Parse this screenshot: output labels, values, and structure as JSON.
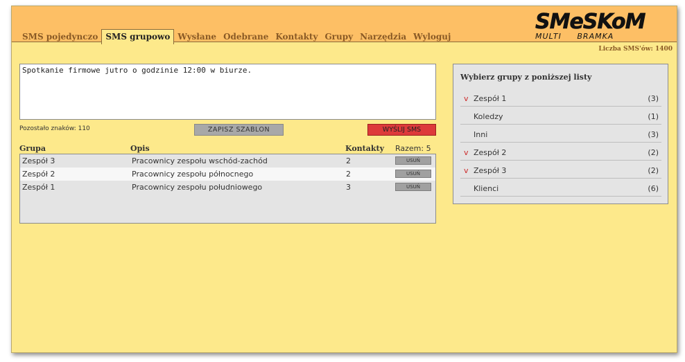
{
  "app": {
    "logo_text": "SMeSKoM",
    "logo_sub": "MULTI BRAMKA"
  },
  "nav": {
    "tabs": [
      {
        "label": "SMS pojedynczo"
      },
      {
        "label": "SMS grupowo"
      },
      {
        "label": "Wysłane"
      },
      {
        "label": "Odebrane"
      },
      {
        "label": "Kontakty"
      },
      {
        "label": "Grupy"
      },
      {
        "label": "Narzędzia"
      },
      {
        "label": "Wyloguj"
      }
    ],
    "active": "SMS grupowo"
  },
  "sms_count": "Liczba SMS'ów: 1400",
  "message": {
    "text": "Spotkanie firmowe jutro o godzinie 12:00 w biurze.",
    "remaining": "Pozostało znaków: 110"
  },
  "buttons": {
    "save_template": "ZAPISZ SZABLON",
    "send": "WYŚLIJ SMS",
    "remove": "USUŃ"
  },
  "table": {
    "headers": {
      "group": "Grupa",
      "description": "Opis",
      "contacts": "Kontakty",
      "total": "Razem: 5"
    },
    "rows": [
      {
        "group": "Zespół 3",
        "description": "Pracownicy zespołu wschód-zachód",
        "contacts": "2"
      },
      {
        "group": "Zespół 2",
        "description": "Pracownicy zespołu północnego",
        "contacts": "2"
      },
      {
        "group": "Zespół 1",
        "description": "Pracownicy zespołu południowego",
        "contacts": "3"
      }
    ]
  },
  "groups": {
    "title": "Wybierz grupy z poniższej listy",
    "check_mark": "v",
    "items": [
      {
        "name": "Zespół 1",
        "count": "(3)",
        "selected": true
      },
      {
        "name": "Koledzy",
        "count": "(1)",
        "selected": false
      },
      {
        "name": "Inni",
        "count": "(3)",
        "selected": false
      },
      {
        "name": "Zespół 2",
        "count": "(2)",
        "selected": true
      },
      {
        "name": "Zespół 3",
        "count": "(2)",
        "selected": true
      },
      {
        "name": "Klienci",
        "count": "(6)",
        "selected": false
      }
    ]
  },
  "colors": {
    "header": "#fdbf65",
    "background": "#fde98b",
    "send_button": "#dd3a3a",
    "nav_text": "#8a5a25"
  }
}
